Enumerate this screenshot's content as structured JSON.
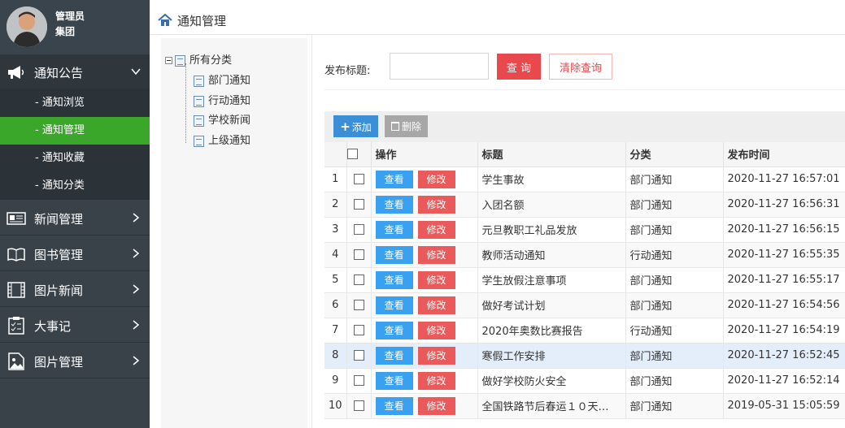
{
  "user": {
    "name": "管理员",
    "org": "集团"
  },
  "sidebar": {
    "groups": [
      {
        "label": "通知公告",
        "icon": "megaphone-icon"
      },
      {
        "label": "新闻管理",
        "icon": "newspaper-icon"
      },
      {
        "label": "图书管理",
        "icon": "book-icon"
      },
      {
        "label": "图片新闻",
        "icon": "film-icon"
      },
      {
        "label": "大事记",
        "icon": "checklist-icon"
      },
      {
        "label": "图片管理",
        "icon": "image-icon"
      }
    ],
    "submenu": [
      "- 通知浏览",
      "- 通知管理",
      "- 通知收藏",
      "- 通知分类"
    ],
    "active_submenu": "- 通知管理",
    "accent": "#3aa72b"
  },
  "header": {
    "title": "通知管理"
  },
  "tree": {
    "root": "所有分类",
    "children": [
      "部门通知",
      "行动通知",
      "学校新闻",
      "上级通知"
    ]
  },
  "search": {
    "label": "发布标题:",
    "value": "",
    "query_label": "查 询",
    "clear_label": "清除查询"
  },
  "toolbar": {
    "add_label": "添加",
    "delete_label": "删除"
  },
  "table": {
    "headers": [
      "操作",
      "标题",
      "分类",
      "发布时间"
    ],
    "view_label": "查看",
    "edit_label": "修改",
    "rows": [
      {
        "no": "1",
        "title": "学生事故",
        "category": "部门通知",
        "time": "2020-11-27 16:57:01"
      },
      {
        "no": "2",
        "title": "入团名额",
        "category": "部门通知",
        "time": "2020-11-27 16:56:31"
      },
      {
        "no": "3",
        "title": "元旦教职工礼品发放",
        "category": "部门通知",
        "time": "2020-11-27 16:56:15"
      },
      {
        "no": "4",
        "title": "教师活动通知",
        "category": "行动通知",
        "time": "2020-11-27 16:55:35"
      },
      {
        "no": "5",
        "title": "学生放假注意事项",
        "category": "部门通知",
        "time": "2020-11-27 16:55:17"
      },
      {
        "no": "6",
        "title": "做好考试计划",
        "category": "部门通知",
        "time": "2020-11-27 16:54:56"
      },
      {
        "no": "7",
        "title": "2020年奥数比赛报告",
        "category": "行动通知",
        "time": "2020-11-27 16:54:19"
      },
      {
        "no": "8",
        "title": "寒假工作安排",
        "category": "部门通知",
        "time": "2020-11-27 16:52:45"
      },
      {
        "no": "9",
        "title": "做好学校防火安全",
        "category": "部门通知",
        "time": "2020-11-27 16:52:14"
      },
      {
        "no": "10",
        "title": "全国铁路节后春运１０天…",
        "category": "部门通知",
        "time": "2019-05-31 15:05:59"
      }
    ],
    "selected_row": "8"
  }
}
